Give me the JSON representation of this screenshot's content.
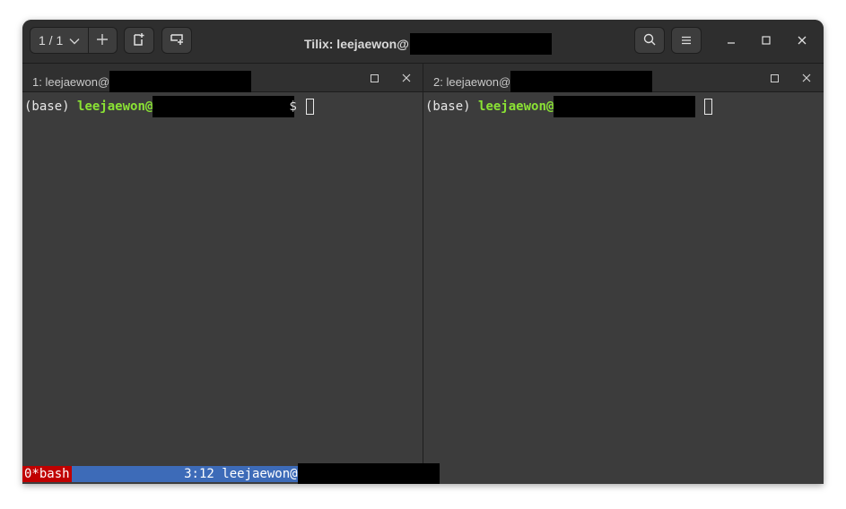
{
  "header": {
    "session_counter": "1 / 1",
    "title": "Tilix: leejaewon@",
    "icons": [
      "chevron-down-icon",
      "plus-icon",
      "split-right-icon",
      "split-down-icon",
      "search-icon",
      "hamburger-menu-icon",
      "minimize-icon",
      "maximize-icon",
      "close-icon"
    ]
  },
  "panes": [
    {
      "title": "1: leejaewon@",
      "prompt_prefix": "(base) ",
      "prompt_user": "leejaewon@",
      "prompt_tail": "$"
    },
    {
      "title": "2: leejaewon@",
      "prompt_prefix": "(base) ",
      "prompt_user": "leejaewon@"
    }
  ],
  "statusbar": {
    "window_label": "0*bash",
    "time": "3:12",
    "host": "leejaewon@"
  },
  "colors": {
    "prompt_user": "#8ae234",
    "status_window": "#c00000",
    "status_bar": "#3d6bb8",
    "terminal_bg": "#3c3c3c"
  }
}
